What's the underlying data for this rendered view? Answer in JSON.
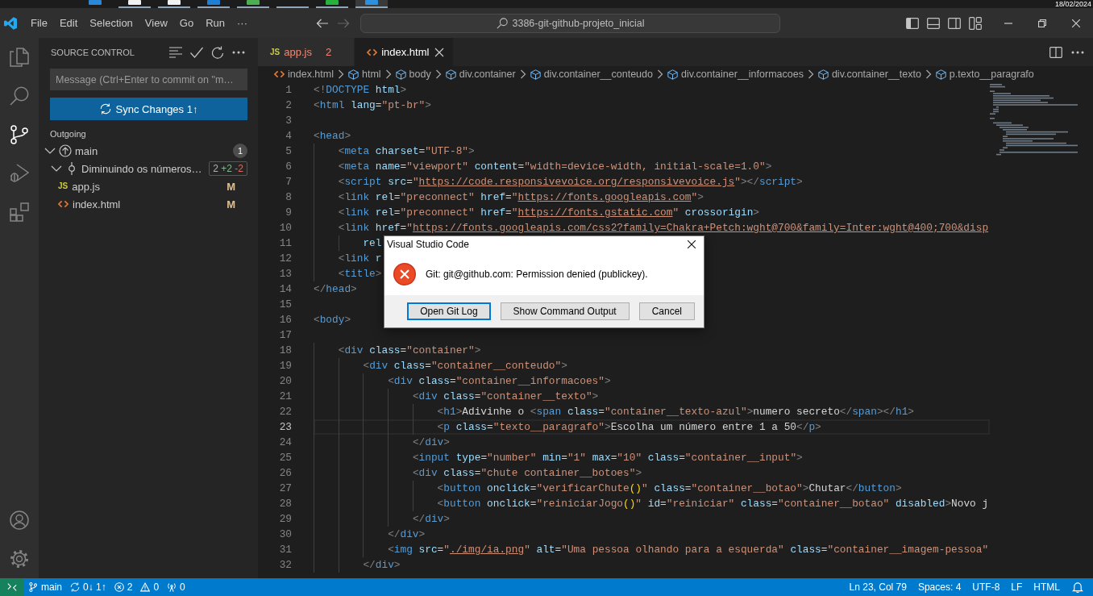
{
  "taskbar": {
    "apps": [
      {
        "color": "#2b88d8",
        "running": false,
        "selected": false
      },
      {
        "color": "#f2f2f2",
        "running": true,
        "selected": false
      },
      {
        "color": "#f2f2f2",
        "running": true,
        "selected": false
      },
      {
        "color": "#1f7fd6",
        "running": true,
        "selected": false
      },
      {
        "color": "#4caf50",
        "running": true,
        "selected": false
      },
      {
        "running": true,
        "selected": false
      },
      {
        "color": "#25b33b",
        "running": true,
        "selected": false
      },
      {
        "color": "#2d8fe0",
        "running": true,
        "selected": true
      }
    ],
    "date": "18/02/2024"
  },
  "titlebar": {
    "menu": [
      "File",
      "Edit",
      "Selection",
      "View",
      "Go",
      "Run",
      "···"
    ],
    "nav": [
      {
        "kind": "back",
        "disabled": false
      },
      {
        "kind": "forward",
        "disabled": true
      }
    ],
    "command_center": "3386-git-github-projeto_inicial",
    "layout_toggles": [
      {
        "kind": "primary-sidebar",
        "on": true
      },
      {
        "kind": "panel",
        "on": false
      },
      {
        "kind": "secondary-sidebar",
        "on": false
      }
    ]
  },
  "activity_bar": {
    "items": [
      {
        "kind": "explorer",
        "selected": false
      },
      {
        "kind": "search",
        "selected": false
      },
      {
        "kind": "source-control",
        "selected": true
      },
      {
        "kind": "run-debug",
        "selected": false
      },
      {
        "kind": "extensions",
        "selected": false
      }
    ],
    "bottom": [
      {
        "kind": "accounts"
      },
      {
        "kind": "manage"
      }
    ]
  },
  "sidebar": {
    "title": "SOURCE CONTROL",
    "commit_message": {
      "placeholder": "Message (Ctrl+Enter to commit on \"m…"
    },
    "sync_button": "Sync Changes 1↑",
    "section": "Outgoing",
    "branch": {
      "name": "main",
      "count": "1",
      "expanded": true
    },
    "commit": {
      "message": "Diminuindo os números…",
      "expanded": true,
      "stats": {
        "files": "2",
        "added": "+2",
        "removed": "-2"
      }
    },
    "files": [
      {
        "name": "app.js",
        "kind": "js",
        "icon_text": "JS",
        "status": "M"
      },
      {
        "name": "index.html",
        "kind": "html",
        "status": "M"
      }
    ]
  },
  "editor": {
    "tabs": [
      {
        "label": "app.js",
        "kind": "js",
        "icon_text": "JS",
        "problems": "2",
        "has_errors": true,
        "selected": false
      },
      {
        "label": "index.html",
        "kind": "html",
        "has_errors": false,
        "selected": true
      }
    ],
    "breadcrumb": [
      {
        "kind": "file",
        "label": "index.html"
      },
      {
        "kind": "element",
        "label": "html"
      },
      {
        "kind": "element",
        "label": "body"
      },
      {
        "kind": "element",
        "label": "div.container"
      },
      {
        "kind": "element",
        "label": "div.container__conteudo"
      },
      {
        "kind": "element",
        "label": "div.container__informacoes"
      },
      {
        "kind": "element",
        "label": "div.container__texto"
      },
      {
        "kind": "element",
        "label": "p.texto__paragrafo"
      }
    ],
    "lines": [
      {
        "number": "1",
        "current": false,
        "tokens": [
          {
            "kind": "punct",
            "text": "<!"
          },
          {
            "kind": "tag",
            "text": "DOCTYPE"
          },
          {
            "kind": "attr",
            "text": " html"
          },
          {
            "kind": "punct",
            "text": ">"
          }
        ]
      },
      {
        "number": "2",
        "current": false,
        "tokens": [
          {
            "kind": "punct",
            "text": "<"
          },
          {
            "kind": "tag",
            "text": "html"
          },
          {
            "kind": "attr",
            "text": " lang"
          },
          {
            "kind": "text",
            "text": "="
          },
          {
            "kind": "string",
            "text": "\"pt-br\""
          },
          {
            "kind": "punct",
            "text": ">"
          }
        ]
      },
      {
        "number": "3",
        "current": false
      },
      {
        "number": "4",
        "current": false,
        "tokens": [
          {
            "kind": "punct",
            "text": "<"
          },
          {
            "kind": "tag",
            "text": "head"
          },
          {
            "kind": "punct",
            "text": ">"
          }
        ]
      },
      {
        "number": "5",
        "current": false,
        "tokens": [
          {
            "kind": "punct",
            "text": "    <"
          },
          {
            "kind": "tag",
            "text": "meta"
          },
          {
            "kind": "attr",
            "text": " charset"
          },
          {
            "kind": "text",
            "text": "="
          },
          {
            "kind": "string",
            "text": "\"UTF-8\""
          },
          {
            "kind": "punct",
            "text": ">"
          }
        ]
      },
      {
        "number": "6",
        "current": false,
        "tokens": [
          {
            "kind": "punct",
            "text": "    <"
          },
          {
            "kind": "tag",
            "text": "meta"
          },
          {
            "kind": "attr",
            "text": " name"
          },
          {
            "kind": "text",
            "text": "="
          },
          {
            "kind": "string",
            "text": "\"viewport\""
          },
          {
            "kind": "attr",
            "text": " content"
          },
          {
            "kind": "text",
            "text": "="
          },
          {
            "kind": "string",
            "text": "\"width=device-width, initial-scale=1.0\""
          },
          {
            "kind": "punct",
            "text": ">"
          }
        ]
      },
      {
        "number": "7",
        "current": false,
        "tokens": [
          {
            "kind": "punct",
            "text": "    <"
          },
          {
            "kind": "tag",
            "text": "script"
          },
          {
            "kind": "attr",
            "text": " src"
          },
          {
            "kind": "text",
            "text": "="
          },
          {
            "kind": "string",
            "text": "\""
          },
          {
            "kind": "link",
            "text": "https://code.responsivevoice.org/responsivevoice.js"
          },
          {
            "kind": "string",
            "text": "\""
          },
          {
            "kind": "punct",
            "text": "></"
          },
          {
            "kind": "tag",
            "text": "script"
          },
          {
            "kind": "punct",
            "text": ">"
          }
        ]
      },
      {
        "number": "8",
        "current": false,
        "tokens": [
          {
            "kind": "punct",
            "text": "    <"
          },
          {
            "kind": "tag",
            "text": "link"
          },
          {
            "kind": "attr",
            "text": " rel"
          },
          {
            "kind": "text",
            "text": "="
          },
          {
            "kind": "string",
            "text": "\"preconnect\""
          },
          {
            "kind": "attr",
            "text": " href"
          },
          {
            "kind": "text",
            "text": "="
          },
          {
            "kind": "string",
            "text": "\""
          },
          {
            "kind": "link",
            "text": "https://fonts.googleapis.com"
          },
          {
            "kind": "string",
            "text": "\""
          },
          {
            "kind": "punct",
            "text": ">"
          }
        ]
      },
      {
        "number": "9",
        "current": false,
        "tokens": [
          {
            "kind": "punct",
            "text": "    <"
          },
          {
            "kind": "tag",
            "text": "link"
          },
          {
            "kind": "attr",
            "text": " rel"
          },
          {
            "kind": "text",
            "text": "="
          },
          {
            "kind": "string",
            "text": "\"preconnect\""
          },
          {
            "kind": "attr",
            "text": " href"
          },
          {
            "kind": "text",
            "text": "="
          },
          {
            "kind": "string",
            "text": "\""
          },
          {
            "kind": "link",
            "text": "https://fonts.gstatic.com"
          },
          {
            "kind": "string",
            "text": "\""
          },
          {
            "kind": "attr",
            "text": " crossorigin"
          },
          {
            "kind": "punct",
            "text": ">"
          }
        ]
      },
      {
        "number": "10",
        "current": false,
        "tokens": [
          {
            "kind": "punct",
            "text": "    <"
          },
          {
            "kind": "tag",
            "text": "link"
          },
          {
            "kind": "attr",
            "text": " href"
          },
          {
            "kind": "text",
            "text": "="
          },
          {
            "kind": "string",
            "text": "\""
          },
          {
            "kind": "link",
            "text": "https://fonts.googleapis.com/css2?family=Chakra+Petch:wght@700&family=Inter:wght@400;700&disp"
          }
        ]
      },
      {
        "number": "11",
        "current": false,
        "tokens": [
          {
            "kind": "attr",
            "text": "        rel"
          }
        ]
      },
      {
        "number": "12",
        "current": false,
        "tokens": [
          {
            "kind": "punct",
            "text": "    <"
          },
          {
            "kind": "tag",
            "text": "link"
          },
          {
            "kind": "attr",
            "text": " r"
          }
        ]
      },
      {
        "number": "13",
        "current": false,
        "tokens": [
          {
            "kind": "punct",
            "text": "    <"
          },
          {
            "kind": "tag",
            "text": "title"
          },
          {
            "kind": "punct",
            "text": ">"
          }
        ]
      },
      {
        "number": "14",
        "current": false,
        "tokens": [
          {
            "kind": "punct",
            "text": "</"
          },
          {
            "kind": "tag",
            "text": "head"
          },
          {
            "kind": "punct",
            "text": ">"
          }
        ]
      },
      {
        "number": "15",
        "current": false
      },
      {
        "number": "16",
        "current": false,
        "tokens": [
          {
            "kind": "punct",
            "text": "<"
          },
          {
            "kind": "tag",
            "text": "body"
          },
          {
            "kind": "punct",
            "text": ">"
          }
        ]
      },
      {
        "number": "17",
        "current": false
      },
      {
        "number": "18",
        "current": false,
        "tokens": [
          {
            "kind": "punct",
            "text": "    <"
          },
          {
            "kind": "tag",
            "text": "div"
          },
          {
            "kind": "attr",
            "text": " class"
          },
          {
            "kind": "text",
            "text": "="
          },
          {
            "kind": "string",
            "text": "\"container\""
          },
          {
            "kind": "punct",
            "text": ">"
          }
        ]
      },
      {
        "number": "19",
        "current": false,
        "tokens": [
          {
            "kind": "punct",
            "text": "        <"
          },
          {
            "kind": "tag",
            "text": "div"
          },
          {
            "kind": "attr",
            "text": " class"
          },
          {
            "kind": "text",
            "text": "="
          },
          {
            "kind": "string",
            "text": "\"container__conteudo\""
          },
          {
            "kind": "punct",
            "text": ">"
          }
        ]
      },
      {
        "number": "20",
        "current": false,
        "tokens": [
          {
            "kind": "punct",
            "text": "            <"
          },
          {
            "kind": "tag",
            "text": "div"
          },
          {
            "kind": "attr",
            "text": " class"
          },
          {
            "kind": "text",
            "text": "="
          },
          {
            "kind": "string",
            "text": "\"container__informacoes\""
          },
          {
            "kind": "punct",
            "text": ">"
          }
        ]
      },
      {
        "number": "21",
        "current": false,
        "tokens": [
          {
            "kind": "punct",
            "text": "                <"
          },
          {
            "kind": "tag",
            "text": "div"
          },
          {
            "kind": "attr",
            "text": " class"
          },
          {
            "kind": "text",
            "text": "="
          },
          {
            "kind": "string",
            "text": "\"container__texto\""
          },
          {
            "kind": "punct",
            "text": ">"
          }
        ]
      },
      {
        "number": "22",
        "current": false,
        "tokens": [
          {
            "kind": "punct",
            "text": "                    <"
          },
          {
            "kind": "tag",
            "text": "h1"
          },
          {
            "kind": "punct",
            "text": ">"
          },
          {
            "kind": "text",
            "text": "Adivinhe o "
          },
          {
            "kind": "punct",
            "text": "<"
          },
          {
            "kind": "tag",
            "text": "span"
          },
          {
            "kind": "attr",
            "text": " class"
          },
          {
            "kind": "text",
            "text": "="
          },
          {
            "kind": "string",
            "text": "\"container__texto-azul\""
          },
          {
            "kind": "punct",
            "text": ">"
          },
          {
            "kind": "text",
            "text": "numero secreto"
          },
          {
            "kind": "punct",
            "text": "</"
          },
          {
            "kind": "tag",
            "text": "span"
          },
          {
            "kind": "punct",
            "text": "></"
          },
          {
            "kind": "tag",
            "text": "h1"
          },
          {
            "kind": "punct",
            "text": ">"
          }
        ]
      },
      {
        "number": "23",
        "current": true,
        "tokens": [
          {
            "kind": "punct",
            "text": "                    <"
          },
          {
            "kind": "tag",
            "text": "p"
          },
          {
            "kind": "attr",
            "text": " class"
          },
          {
            "kind": "text",
            "text": "="
          },
          {
            "kind": "string",
            "text": "\"texto__paragrafo\""
          },
          {
            "kind": "punct",
            "text": ">"
          },
          {
            "kind": "text",
            "text": "Escolha um número entre 1 a 50"
          },
          {
            "kind": "punct",
            "text": "</"
          },
          {
            "kind": "tag",
            "text": "p"
          },
          {
            "kind": "punct",
            "text": ">"
          }
        ]
      },
      {
        "number": "24",
        "current": false,
        "tokens": [
          {
            "kind": "punct",
            "text": "                </"
          },
          {
            "kind": "tag",
            "text": "div"
          },
          {
            "kind": "punct",
            "text": ">"
          }
        ]
      },
      {
        "number": "25",
        "current": false,
        "tokens": [
          {
            "kind": "punct",
            "text": "                <"
          },
          {
            "kind": "tag",
            "text": "input"
          },
          {
            "kind": "attr",
            "text": " type"
          },
          {
            "kind": "text",
            "text": "="
          },
          {
            "kind": "string",
            "text": "\"number\""
          },
          {
            "kind": "attr",
            "text": " min"
          },
          {
            "kind": "text",
            "text": "="
          },
          {
            "kind": "string",
            "text": "\"1\""
          },
          {
            "kind": "attr",
            "text": " max"
          },
          {
            "kind": "text",
            "text": "="
          },
          {
            "kind": "string",
            "text": "\"10\""
          },
          {
            "kind": "attr",
            "text": " class"
          },
          {
            "kind": "text",
            "text": "="
          },
          {
            "kind": "string",
            "text": "\"container__input\""
          },
          {
            "kind": "punct",
            "text": ">"
          }
        ]
      },
      {
        "number": "26",
        "current": false,
        "tokens": [
          {
            "kind": "punct",
            "text": "                <"
          },
          {
            "kind": "tag",
            "text": "div"
          },
          {
            "kind": "attr",
            "text": " class"
          },
          {
            "kind": "text",
            "text": "="
          },
          {
            "kind": "string",
            "text": "\"chute container__botoes\""
          },
          {
            "kind": "punct",
            "text": ">"
          }
        ]
      },
      {
        "number": "27",
        "current": false,
        "tokens": [
          {
            "kind": "punct",
            "text": "                    <"
          },
          {
            "kind": "tag",
            "text": "button"
          },
          {
            "kind": "attr",
            "text": " onclick"
          },
          {
            "kind": "text",
            "text": "="
          },
          {
            "kind": "string",
            "text": "\"verificarChute"
          },
          {
            "kind": "paren",
            "text": "()"
          },
          {
            "kind": "string",
            "text": "\""
          },
          {
            "kind": "attr",
            "text": " class"
          },
          {
            "kind": "text",
            "text": "="
          },
          {
            "kind": "string",
            "text": "\"container__botao\""
          },
          {
            "kind": "punct",
            "text": ">"
          },
          {
            "kind": "text",
            "text": "Chutar"
          },
          {
            "kind": "punct",
            "text": "</"
          },
          {
            "kind": "tag",
            "text": "button"
          },
          {
            "kind": "punct",
            "text": ">"
          }
        ]
      },
      {
        "number": "28",
        "current": false,
        "tokens": [
          {
            "kind": "punct",
            "text": "                    <"
          },
          {
            "kind": "tag",
            "text": "button"
          },
          {
            "kind": "attr",
            "text": " onclick"
          },
          {
            "kind": "text",
            "text": "="
          },
          {
            "kind": "string",
            "text": "\"reiniciarJogo"
          },
          {
            "kind": "paren",
            "text": "()"
          },
          {
            "kind": "string",
            "text": "\""
          },
          {
            "kind": "attr",
            "text": " id"
          },
          {
            "kind": "text",
            "text": "="
          },
          {
            "kind": "string",
            "text": "\"reiniciar\""
          },
          {
            "kind": "attr",
            "text": " class"
          },
          {
            "kind": "text",
            "text": "="
          },
          {
            "kind": "string",
            "text": "\"container__botao\""
          },
          {
            "kind": "attr",
            "text": " disabled"
          },
          {
            "kind": "punct",
            "text": ">"
          },
          {
            "kind": "text",
            "text": "Novo j"
          }
        ]
      },
      {
        "number": "29",
        "current": false,
        "tokens": [
          {
            "kind": "punct",
            "text": "                </"
          },
          {
            "kind": "tag",
            "text": "div"
          },
          {
            "kind": "punct",
            "text": ">"
          }
        ]
      },
      {
        "number": "30",
        "current": false,
        "tokens": [
          {
            "kind": "punct",
            "text": "            </"
          },
          {
            "kind": "tag",
            "text": "div"
          },
          {
            "kind": "punct",
            "text": ">"
          }
        ]
      },
      {
        "number": "31",
        "current": false,
        "tokens": [
          {
            "kind": "punct",
            "text": "            <"
          },
          {
            "kind": "tag",
            "text": "img"
          },
          {
            "kind": "attr",
            "text": " src"
          },
          {
            "kind": "text",
            "text": "="
          },
          {
            "kind": "string",
            "text": "\""
          },
          {
            "kind": "link",
            "text": "./img/ia.png"
          },
          {
            "kind": "string",
            "text": "\""
          },
          {
            "kind": "attr",
            "text": " alt"
          },
          {
            "kind": "text",
            "text": "="
          },
          {
            "kind": "string",
            "text": "\"Uma pessoa olhando para a esquerda\""
          },
          {
            "kind": "attr",
            "text": " class"
          },
          {
            "kind": "text",
            "text": "="
          },
          {
            "kind": "string",
            "text": "\"container__imagem-pessoa\""
          }
        ]
      },
      {
        "number": "32",
        "current": false,
        "tokens": [
          {
            "kind": "punct",
            "text": "        </"
          },
          {
            "kind": "tag",
            "text": "div"
          },
          {
            "kind": "punct",
            "text": ">"
          }
        ]
      }
    ]
  },
  "dialog": {
    "title": "Visual Studio Code",
    "message": "Git: git@github.com: Permission denied (publickey).",
    "buttons": [
      {
        "label": "Open Git Log",
        "focused": true
      },
      {
        "label": "Show Command Output",
        "focused": false
      },
      {
        "label": "Cancel",
        "focused": false
      }
    ]
  },
  "status_bar": {
    "branch": "main",
    "sync": "0↓ 1↑",
    "errors": "2",
    "warnings": "0",
    "ports": "0",
    "items": [
      "Ln 23, Col 79",
      "Spaces: 4",
      "UTF-8",
      "LF",
      "HTML"
    ]
  }
}
